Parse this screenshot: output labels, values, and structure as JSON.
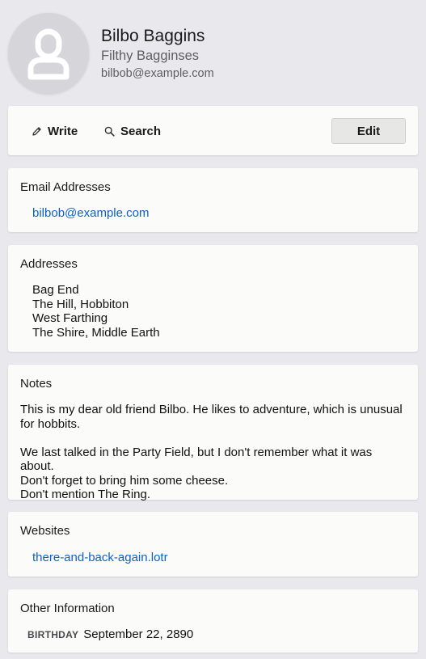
{
  "contact": {
    "name": "Bilbo Baggins",
    "organization": "Filthy Bagginses",
    "email": "bilbob@example.com"
  },
  "toolbar": {
    "write_label": "Write",
    "search_label": "Search",
    "edit_label": "Edit"
  },
  "email_section": {
    "title": "Email Addresses",
    "items": [
      "bilbob@example.com"
    ]
  },
  "address_section": {
    "title": "Addresses",
    "lines": [
      "Bag End",
      "The Hill, Hobbiton",
      "West Farthing",
      "The Shire, Middle Earth"
    ]
  },
  "notes_section": {
    "title": "Notes",
    "paragraphs": [
      "This is my dear old friend Bilbo. He likes to adventure, which is unusual for hobbits.",
      "We last talked in the Party Field, but I don't remember what it was about.\nDon't forget to bring him some cheese.\nDon't mention The Ring."
    ]
  },
  "website_section": {
    "title": "Websites",
    "items": [
      "there-and-back-again.lotr"
    ]
  },
  "other_section": {
    "title": "Other Information",
    "birthday_label": "BIRTHDAY",
    "birthday_value": "September 22, 2890"
  },
  "icons": {
    "avatar": "person-icon",
    "write": "pencil-icon",
    "search": "search-icon"
  },
  "colors": {
    "page_background": "#e9e8ed",
    "card_background": "#fbfbfa",
    "link": "#0a62c9",
    "avatar_background": "#d6d5da"
  }
}
